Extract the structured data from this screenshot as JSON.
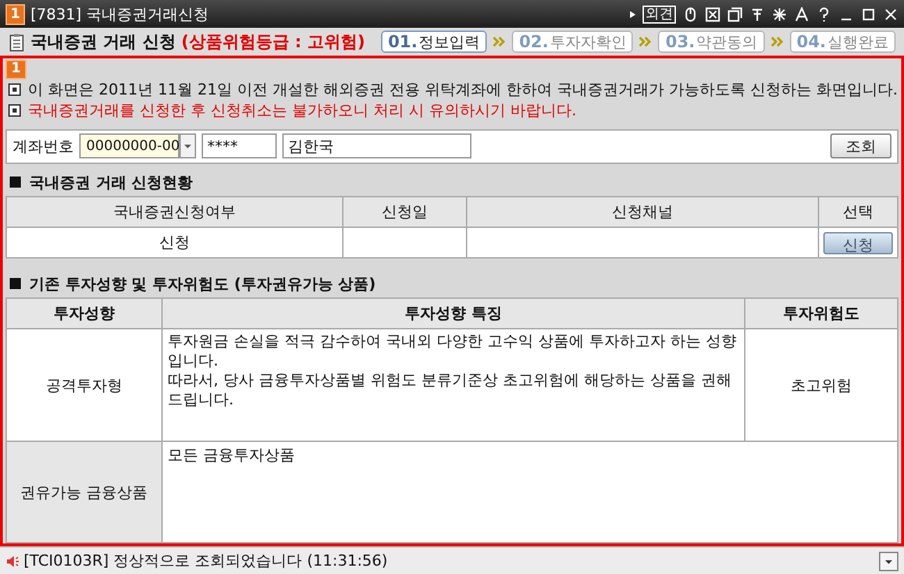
{
  "window": {
    "badge": "1",
    "title": "[7831] 국내증권거래신청",
    "tool_text": "외견"
  },
  "header": {
    "title": "국내증권 거래 신청",
    "risk": "(상품위험등급 : 고위험)",
    "steps": [
      {
        "number": "01.",
        "label": "정보입력",
        "selected": true
      },
      {
        "number": "02.",
        "label": "투자자확인",
        "selected": false
      },
      {
        "number": "03.",
        "label": "약관동의",
        "selected": false
      },
      {
        "number": "04.",
        "label": "실행완료",
        "selected": false
      }
    ]
  },
  "panel_badge": "1",
  "notices": [
    {
      "kind": "normal",
      "text": "이 화면은 2011년 11월 21일 이전 개설한 해외증권 전용 위탁계좌에 한하여 국내증권거래가 가능하도록 신청하는 화면입니다."
    },
    {
      "kind": "warning",
      "text": "국내증권거래를 신청한 후 신청취소는 불가하오니 처리 시 유의하시기 바랍니다."
    }
  ],
  "account": {
    "label": "계좌번호",
    "number": "00000000-00",
    "password": "****",
    "name": "김한국",
    "button": "조회"
  },
  "application": {
    "title": "국내증권 거래 신청현황",
    "columns": [
      "국내증권신청여부",
      "신청일",
      "신청채널",
      "선택"
    ],
    "rows": [
      {
        "status": "신청",
        "button": "신청"
      }
    ]
  },
  "profile": {
    "title": "기존 투자성향 및 투자위험도 (투자권유가능 상품)",
    "columns": [
      "투자성향",
      "투자성향 특징",
      "투자위험도"
    ],
    "rows": [
      {
        "type": "공격투자형",
        "description": [
          "투자원금 손실을 적극 감수하여 국내외 다양한 고수익 상품에 투자하고자 하는 성향입니다.",
          "따라서, 당사 금융투자상품별 위험도 분류기준상 초고위험에 해당하는 상품을 권해 드립니다."
        ],
        "risk": "초고위험"
      }
    ],
    "products": {
      "label": "권유가능 금융상품",
      "value": "모든 금융투자상품"
    }
  },
  "status_bar": {
    "message": "[TCI0103R] 정상적으로 조회되었습니다 (11:31:56)"
  }
}
